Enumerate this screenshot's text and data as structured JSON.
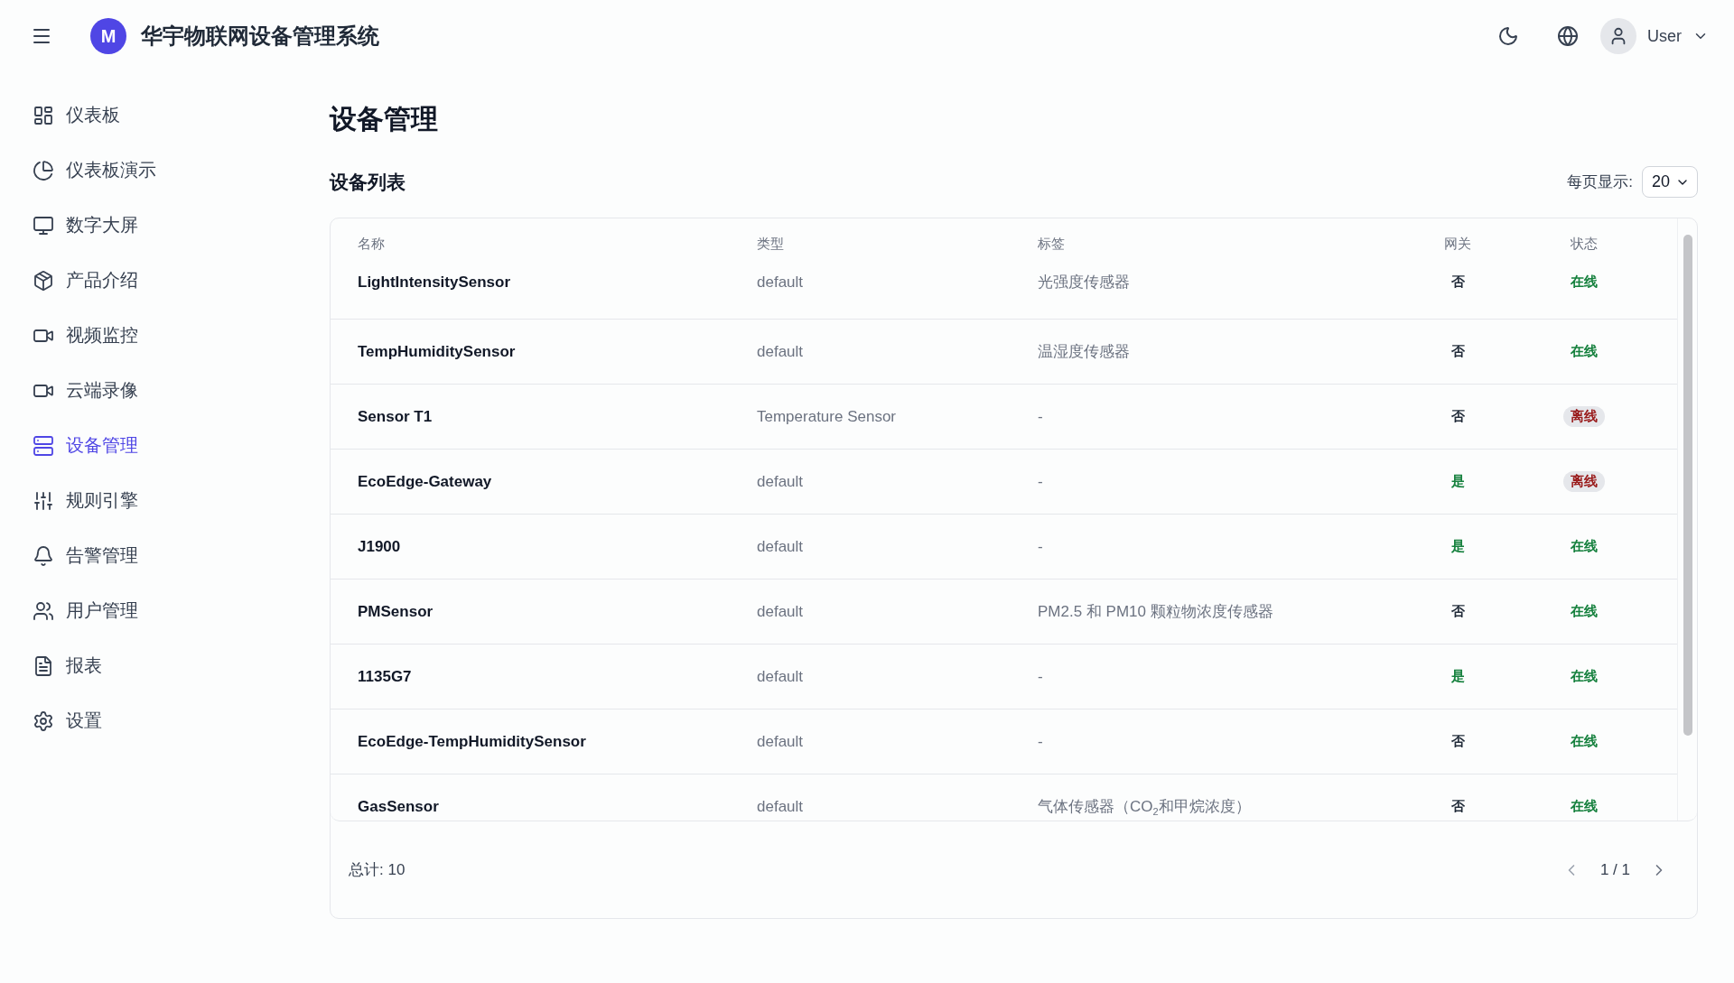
{
  "header": {
    "logo_letter": "M",
    "title": "华宇物联网设备管理系统",
    "user": "User"
  },
  "sidebar": {
    "items": [
      {
        "label": "仪表板",
        "selected": false
      },
      {
        "label": "仪表板演示",
        "selected": false
      },
      {
        "label": "数字大屏",
        "selected": false
      },
      {
        "label": "产品介绍",
        "selected": false
      },
      {
        "label": "视频监控",
        "selected": false
      },
      {
        "label": "云端录像",
        "selected": false
      },
      {
        "label": "设备管理",
        "selected": true
      },
      {
        "label": "规则引擎",
        "selected": false
      },
      {
        "label": "告警管理",
        "selected": false
      },
      {
        "label": "用户管理",
        "selected": false
      },
      {
        "label": "报表",
        "selected": false
      },
      {
        "label": "设置",
        "selected": false
      }
    ]
  },
  "page_title": "设备管理",
  "section_title": "设备列表",
  "page_size": {
    "label": "每页显示:",
    "value": "20"
  },
  "table": {
    "columns": [
      "名称",
      "类型",
      "标签",
      "网关",
      "状态"
    ],
    "rows": [
      {
        "name": "LightIntensitySensor",
        "type": "default",
        "tag": "光强度传感器",
        "gateway": "否",
        "is_gateway": false,
        "status": "在线",
        "online": true
      },
      {
        "name": "TempHumiditySensor",
        "type": "default",
        "tag": "温湿度传感器",
        "gateway": "否",
        "is_gateway": false,
        "status": "在线",
        "online": true
      },
      {
        "name": "Sensor T1",
        "type": "Temperature Sensor",
        "tag": "-",
        "gateway": "否",
        "is_gateway": false,
        "status": "离线",
        "online": false
      },
      {
        "name": "EcoEdge-Gateway",
        "type": "default",
        "tag": "-",
        "gateway": "是",
        "is_gateway": true,
        "status": "离线",
        "online": false
      },
      {
        "name": "J1900",
        "type": "default",
        "tag": "-",
        "gateway": "是",
        "is_gateway": true,
        "status": "在线",
        "online": true
      },
      {
        "name": "PMSensor",
        "type": "default",
        "tag": "PM2.5 和 PM10 颗粒物浓度传感器",
        "gateway": "否",
        "is_gateway": false,
        "status": "在线",
        "online": true
      },
      {
        "name": "1135G7",
        "type": "default",
        "tag": "-",
        "gateway": "是",
        "is_gateway": true,
        "status": "在线",
        "online": true
      },
      {
        "name": "EcoEdge-TempHumiditySensor",
        "type": "default",
        "tag": "-",
        "gateway": "否",
        "is_gateway": false,
        "status": "在线",
        "online": true
      },
      {
        "name": "GasSensor",
        "type": "default",
        "tag": "气体传感器（CO$_{2}$和甲烷浓度）",
        "gateway": "否",
        "is_gateway": false,
        "status": "在线",
        "online": true
      }
    ]
  },
  "footer": {
    "total": "总计: 10",
    "page": "1 / 1"
  }
}
